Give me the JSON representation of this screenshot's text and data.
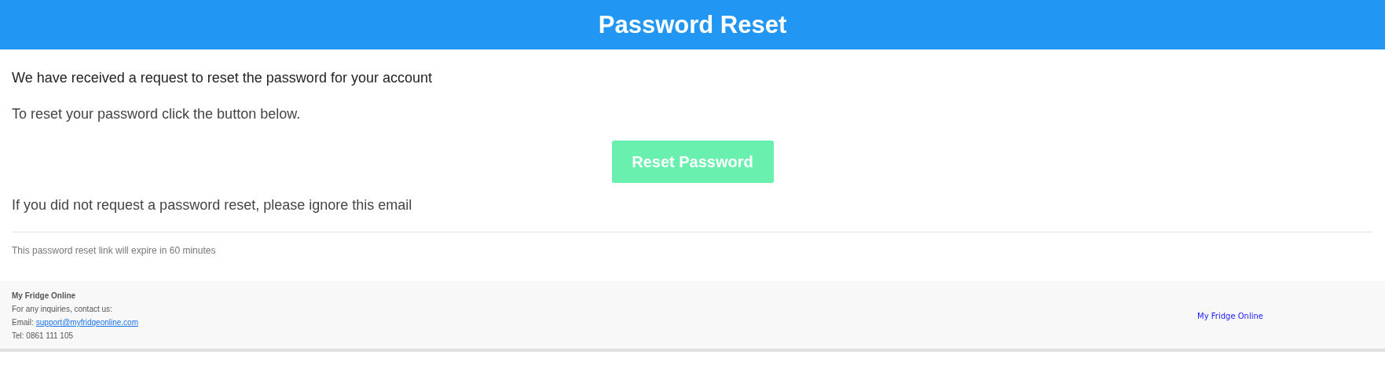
{
  "header": {
    "title": "Password Reset"
  },
  "body": {
    "paragraphs": [
      "We have received a request to reset the password for your account",
      "To reset your password click the button below."
    ],
    "button": "Reset Password",
    "ignore_note": "If you did not request a password reset, please ignore this email",
    "expiry_note": "This password reset link will expire in 60 minutes"
  },
  "footer": {
    "company": "My Fridge Online",
    "inquiries": "For any inquiries, contact us:",
    "email_label": "Email:",
    "email_link": "support@myfridgeonline.com",
    "phone": "Tel: 0861 111 105",
    "brand": "My Fridge Online"
  }
}
